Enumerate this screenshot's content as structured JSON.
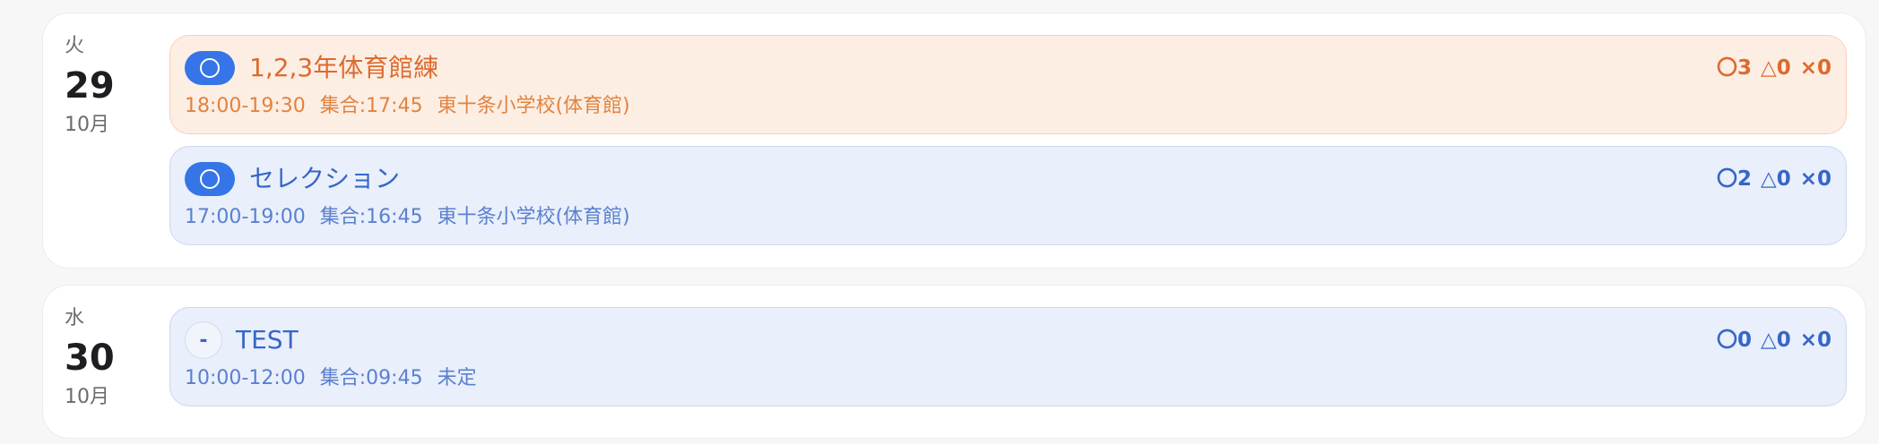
{
  "days": [
    {
      "weekday": "火",
      "day": "29",
      "month": "10月",
      "events": [
        {
          "status": "pill",
          "title": "1,2,3年体育館練",
          "time": "18:00-19:30",
          "meet": "集合:17:45",
          "place": "東十条小学校(体育館)",
          "counts": {
            "yes": "〇3",
            "maybe": "△0",
            "no": "×0"
          },
          "theme": "orange"
        },
        {
          "status": "pill",
          "title": "セレクション",
          "time": "17:00-19:00",
          "meet": "集合:16:45",
          "place": "東十条小学校(体育館)",
          "counts": {
            "yes": "〇2",
            "maybe": "△0",
            "no": "×0"
          },
          "theme": "blue"
        }
      ]
    },
    {
      "weekday": "水",
      "day": "30",
      "month": "10月",
      "events": [
        {
          "status": "dash",
          "status_text": "-",
          "title": "TEST",
          "time": "10:00-12:00",
          "meet": "集合:09:45",
          "place": "未定",
          "counts": {
            "yes": "〇0",
            "maybe": "△0",
            "no": "×0"
          },
          "theme": "blue"
        }
      ]
    }
  ],
  "colors": {
    "accent_blue": "#3575e8",
    "orange_bg": "#fdeee4",
    "orange_text": "#dc6a2d",
    "blue_bg": "#e9effb",
    "blue_text": "#3766c7"
  }
}
